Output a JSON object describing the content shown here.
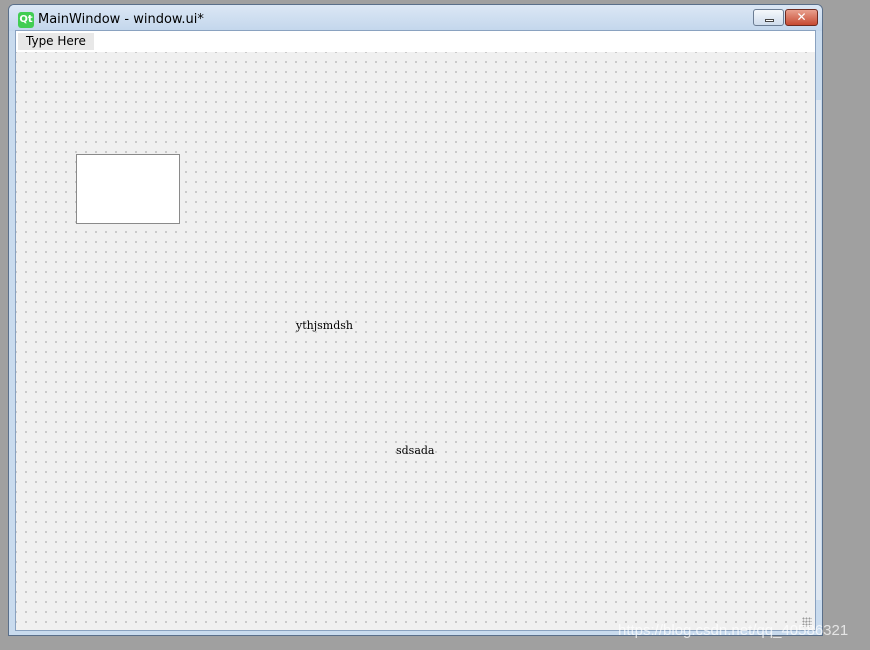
{
  "window": {
    "title": "MainWindow - window.ui*",
    "logo_text": "Qt",
    "close_glyph": "✕"
  },
  "menubar": {
    "items": [
      {
        "label": "Type Here"
      }
    ]
  },
  "form": {
    "labels": [
      {
        "text": "ythjsmdsh"
      },
      {
        "text": "sdsada"
      }
    ]
  },
  "watermark": "https://blog.csdn.net/qq_40586321",
  "colors": {
    "canvas_bg": "#f0f0f0",
    "titlebar": "#c3d6ec",
    "close_button": "#c64a32",
    "qt_green": "#41cd52"
  },
  "icons": [
    "qt-logo-icon",
    "minimize-icon",
    "close-icon",
    "resize-grip-icon"
  ]
}
